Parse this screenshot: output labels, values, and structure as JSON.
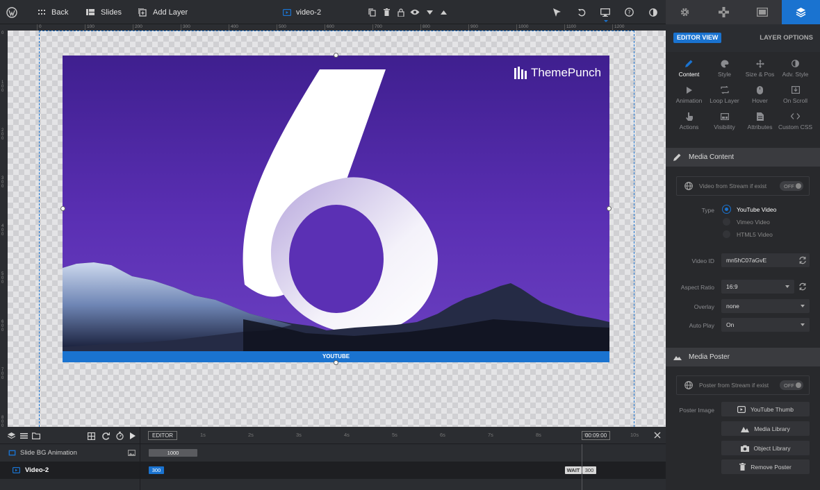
{
  "topbar": {
    "back_label": "Back",
    "slides_label": "Slides",
    "add_layer_label": "Add Layer",
    "layer_name": "video-2"
  },
  "right_panel": {
    "editor_view_label": "EDITOR VIEW",
    "layer_options_label": "LAYER OPTIONS",
    "options": [
      {
        "label": "Content",
        "icon": "pencil-icon"
      },
      {
        "label": "Style",
        "icon": "palette-icon"
      },
      {
        "label": "Size & Pos",
        "icon": "move-icon"
      },
      {
        "label": "Adv. Style",
        "icon": "contrast-icon"
      },
      {
        "label": "Animation",
        "icon": "play-icon"
      },
      {
        "label": "Loop Layer",
        "icon": "loop-icon"
      },
      {
        "label": "Hover",
        "icon": "mouse-icon"
      },
      {
        "label": "On Scroll",
        "icon": "download-icon"
      },
      {
        "label": "Actions",
        "icon": "hand-pointer-icon"
      },
      {
        "label": "Visibility",
        "icon": "visibility-icon"
      },
      {
        "label": "Attributes",
        "icon": "file-icon"
      },
      {
        "label": "Custom CSS",
        "icon": "code-icon"
      }
    ],
    "media_content": {
      "header": "Media Content",
      "stream_label": "Video from Stream if exist",
      "stream_toggle": "OFF",
      "type_label": "Type",
      "type_options": [
        "YouTube Video",
        "Vimeo Video",
        "HTML5 Video"
      ],
      "video_id_label": "Video ID",
      "video_id_value": "mn5hC07aGvE",
      "aspect_ratio_label": "Aspect Ratio",
      "aspect_ratio_value": "16:9",
      "overlay_label": "Overlay",
      "overlay_value": "none",
      "autoplay_label": "Auto Play",
      "autoplay_value": "On"
    },
    "media_poster": {
      "header": "Media Poster",
      "stream_label": "Poster from Stream if exist",
      "stream_toggle": "OFF",
      "poster_image_label": "Poster Image",
      "buttons": [
        "YouTube Thumb",
        "Media Library",
        "Object Library",
        "Remove Poster"
      ]
    }
  },
  "canvas": {
    "ruler_top": [
      "0",
      "100",
      "200",
      "300",
      "400",
      "500",
      "600",
      "700",
      "800",
      "900",
      "1000",
      "1100",
      "1200"
    ],
    "ruler_left": [
      "0",
      "100",
      "200",
      "300",
      "400",
      "500",
      "600",
      "700",
      "800"
    ],
    "logo_text": "ThemePunch",
    "video_label": "YOUTUBE"
  },
  "timeline": {
    "editor_label": "EDITOR",
    "ticks": [
      "1s",
      "2s",
      "3s",
      "4s",
      "5s",
      "6s",
      "7s",
      "8s",
      "9s",
      "10s"
    ],
    "time_value": "00:09:00",
    "rows": [
      {
        "name": "Slide BG Animation",
        "value": "1000"
      },
      {
        "name": "Video-2",
        "value": "300",
        "wait_label": "WAIT",
        "wait_value": "300"
      }
    ]
  },
  "colors": {
    "accent": "#1a73d0",
    "panel_bg": "#28292c",
    "toolbar_bg": "#2b2d31",
    "video_purple": "#5a2ab0"
  }
}
